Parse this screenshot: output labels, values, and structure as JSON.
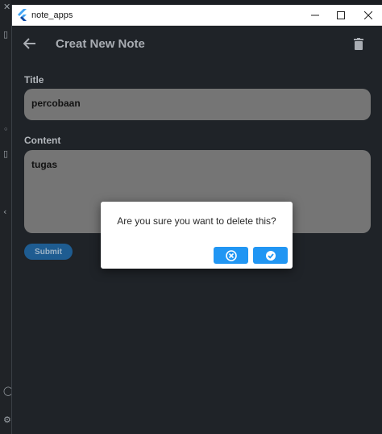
{
  "window": {
    "title": "note_apps"
  },
  "appbar": {
    "title": "Creat New Note"
  },
  "form": {
    "title_label": "Title",
    "title_value": "percobaan",
    "content_label": "Content",
    "content_value": "tugas",
    "submit_label": "Submit"
  },
  "dialog": {
    "message": "Are you sure you want to delete this?"
  },
  "colors": {
    "background": "#1f2328",
    "field": "#757575",
    "submit": "#1e5c91",
    "dialog_button": "#2196f3"
  },
  "icons": {
    "back": "arrow-back-icon",
    "delete": "trash-icon",
    "cancel": "cancel-circle-icon",
    "confirm": "check-circle-icon",
    "app": "flutter-logo-icon"
  }
}
